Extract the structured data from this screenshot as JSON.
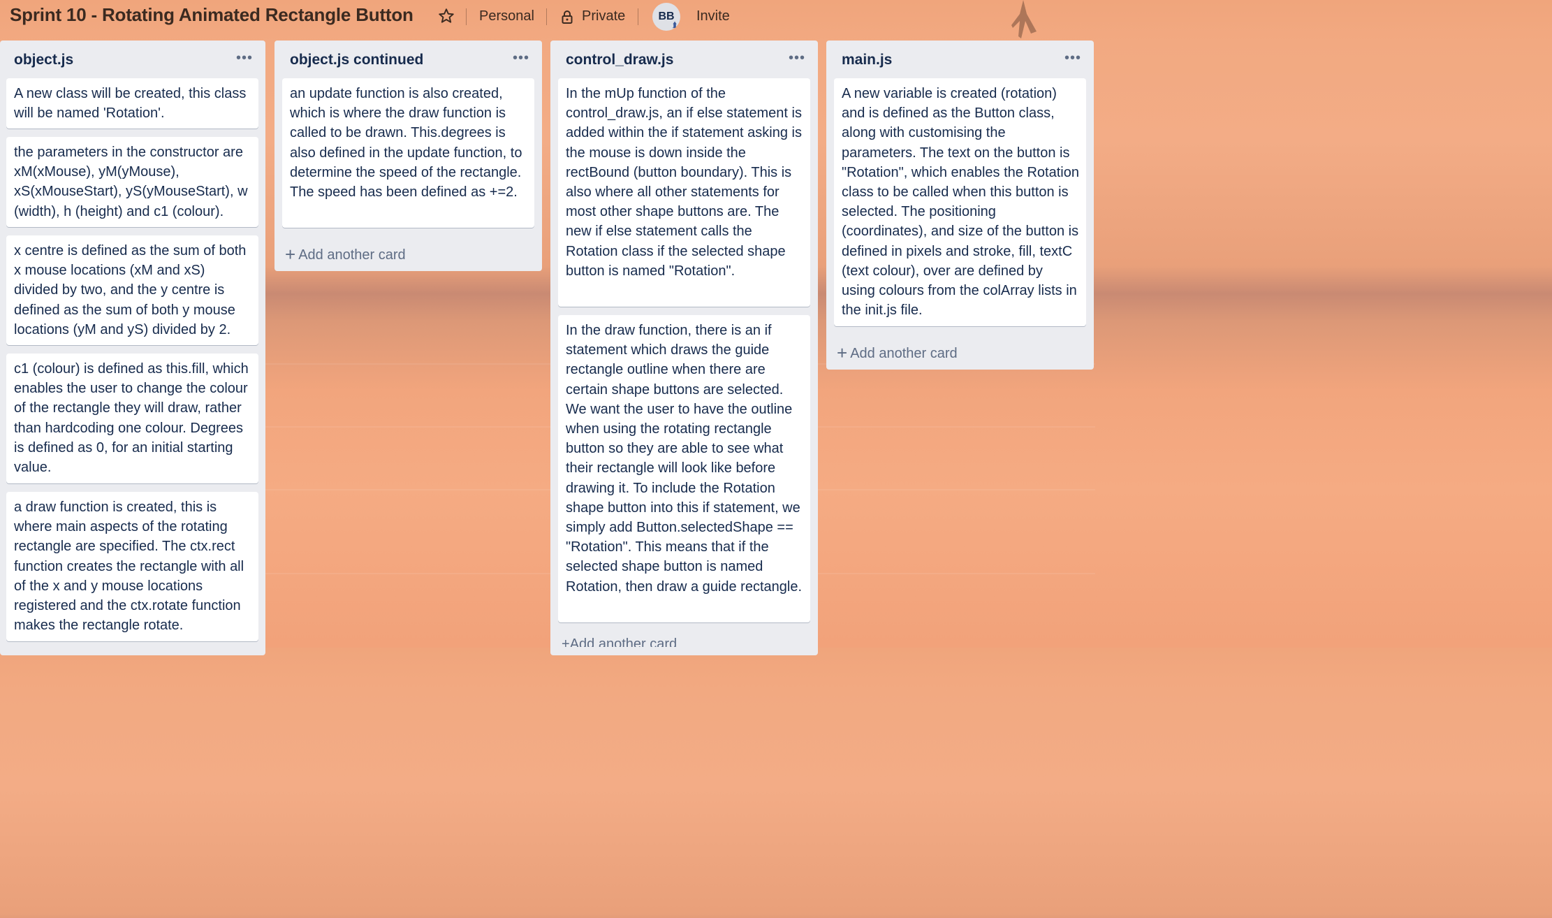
{
  "board": {
    "title": "Sprint 10 - Rotating Animated Rectangle Button",
    "visibility_team": "Personal",
    "visibility_privacy": "Private",
    "member_initials": "BB",
    "invite_label": "Invite"
  },
  "colors": {
    "list_bg": "#ebecf0",
    "card_bg": "#ffffff",
    "text": "#172b4d",
    "muted": "#5e6c84",
    "board_bg": "#f2a87f"
  },
  "list_menu_icon": "ellipsis-icon",
  "lists": [
    {
      "title": "object.js",
      "cards": [
        "A new class will be created, this class will be named 'Rotation'.",
        "the parameters in the constructor are xM(xMouse), yM(yMouse), xS(xMouseStart), yS(yMouseStart), w (width), h (height) and c1 (colour).",
        "x centre is defined as the sum of both x mouse locations (xM and xS) divided by two, and the y centre is defined as the sum of both y mouse locations (yM and yS) divided by 2.",
        "c1 (colour) is defined as this.fill, which enables the user to change the colour of the rectangle they will draw, rather than hardcoding one colour. Degrees is defined as 0, for an initial starting value.",
        "a draw function is created, this is where main aspects of the rotating rectangle are specified. The ctx.rect function creates the rectangle with all of the x and y mouse locations registered and the ctx.rotate function makes the rectangle rotate."
      ]
    },
    {
      "title": "object.js continued",
      "cards": [
        "an update function is also created, which is where the draw function is called to be drawn. This.degrees is also defined in the update function, to determine the speed of the rectangle. The speed has been defined as +=2."
      ],
      "add_card": "Add another card"
    },
    {
      "title": "control_draw.js",
      "cards": [
        "In the mUp function of the control_draw.js, an if else statement is added within the if statement asking is the mouse is down inside the rectBound (button boundary). This is also where all other statements for most other shape buttons are. The new if else statement calls the Rotation class if the selected shape button is named \"Rotation\".",
        "In the draw function, there is an if statement which draws the guide rectangle outline when there are certain shape buttons are selected. We want the user to have the outline when using the rotating rectangle button so they are able to see what their rectangle will look like before drawing it. To include the Rotation shape button into this if statement, we simply add Button.selectedShape == \"Rotation\". This means that if the selected shape button is named Rotation, then draw a guide rectangle."
      ],
      "add_card": "Add another card"
    },
    {
      "title": "main.js",
      "cards": [
        "A new variable is created (rotation) and is defined as the Button class, along with customising the parameters. The text on the button is \"Rotation\", which enables the Rotation class to be called when this button is selected. The positioning (coordinates), and size of the button is defined in pixels and stroke, fill, textC (text colour), over are defined by using colours from the colArray lists in the init.js file."
      ],
      "add_card": "Add another card"
    }
  ]
}
